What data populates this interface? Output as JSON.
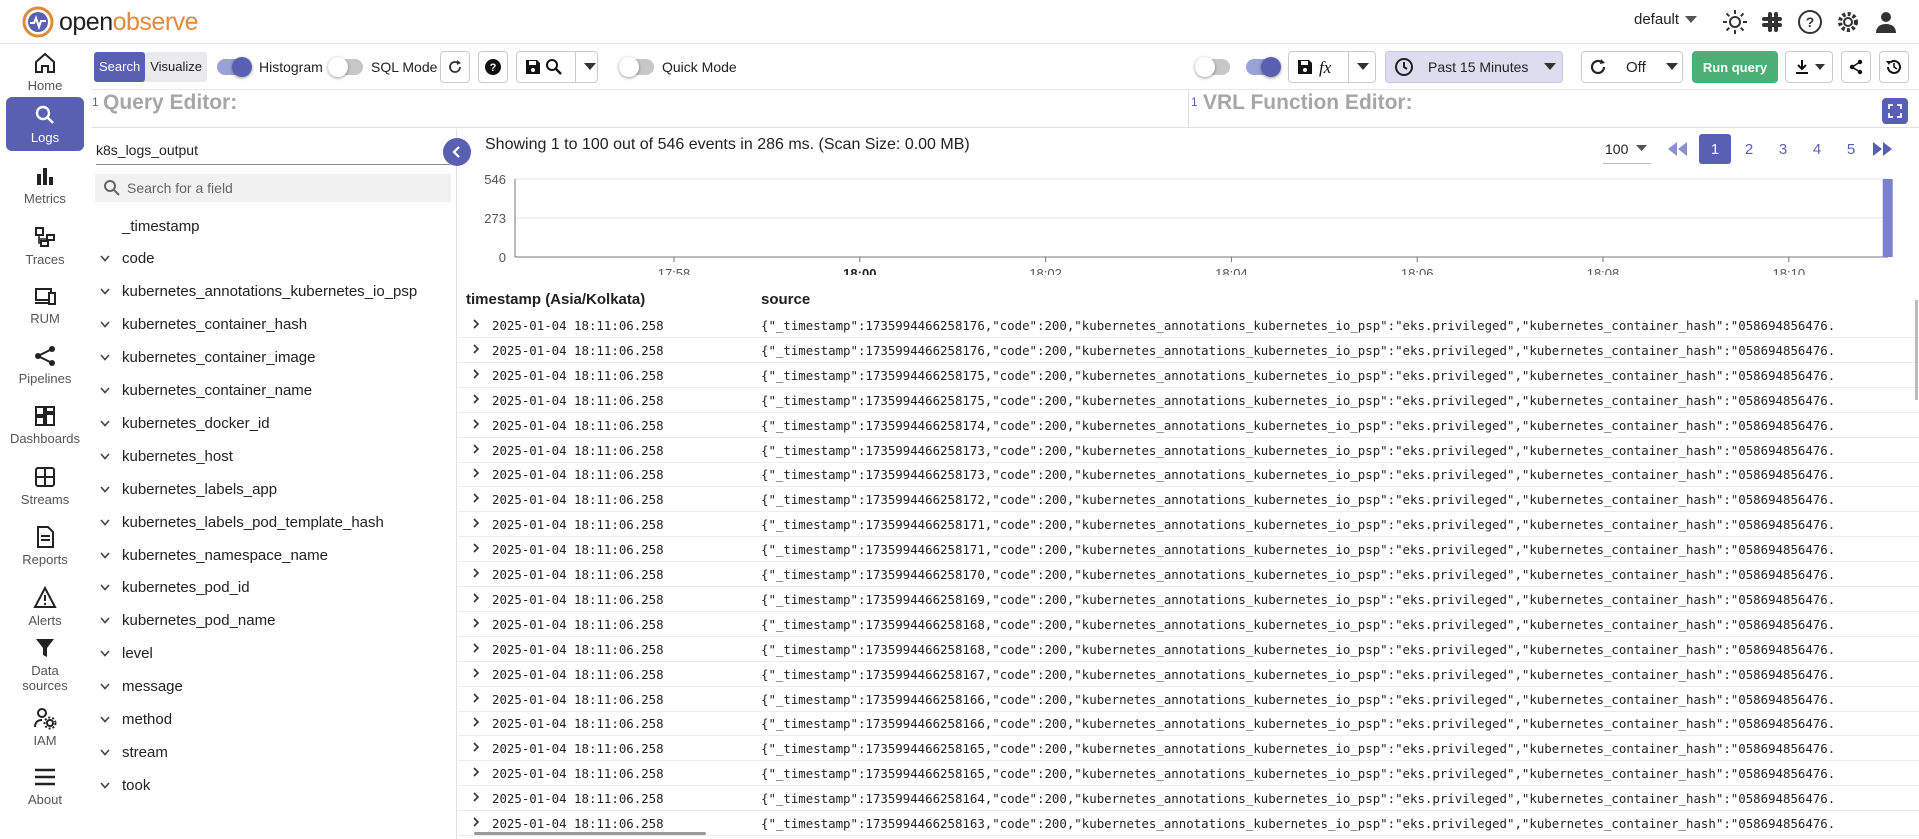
{
  "app": {
    "brand_open": "open",
    "brand_observe": "observe",
    "org": "default"
  },
  "colors": {
    "accent": "#5960b2",
    "bar": "#7b80d0",
    "run": "#4caf76"
  },
  "nav": [
    {
      "label": "Home",
      "icon": "home-icon"
    },
    {
      "label": "Logs",
      "icon": "search-icon",
      "active": true
    },
    {
      "label": "Metrics",
      "icon": "bar-chart-icon"
    },
    {
      "label": "Traces",
      "icon": "traces-icon"
    },
    {
      "label": "RUM",
      "icon": "devices-icon"
    },
    {
      "label": "Pipelines",
      "icon": "share-nodes-icon"
    },
    {
      "label": "Dashboards",
      "icon": "dashboard-grid-icon"
    },
    {
      "label": "Streams",
      "icon": "streams-grid-icon"
    },
    {
      "label": "Reports",
      "icon": "report-doc-icon"
    },
    {
      "label": "Alerts",
      "icon": "warning-icon"
    },
    {
      "label": "Data sources",
      "icon": "funnel-icon"
    },
    {
      "label": "IAM",
      "icon": "users-gear-icon"
    },
    {
      "label": "About",
      "icon": "list-icon"
    }
  ],
  "toolbar": {
    "search_tab": "Search",
    "visualize_tab": "Visualize",
    "histogram": "Histogram",
    "sql_mode": "SQL Mode",
    "quick_mode": "Quick Mode",
    "time_range": "Past 15 Minutes",
    "refresh": "Off",
    "run_query": "Run query"
  },
  "editors": {
    "query_label": "Query Editor:",
    "vrl_label": "VRL Function Editor:",
    "line_number": "1"
  },
  "fields": {
    "stream": "k8s_logs_output",
    "search_placeholder": "Search for a field",
    "items": [
      "_timestamp",
      "code",
      "kubernetes_annotations_kubernetes_io_psp",
      "kubernetes_container_hash",
      "kubernetes_container_image",
      "kubernetes_container_name",
      "kubernetes_docker_id",
      "kubernetes_host",
      "kubernetes_labels_app",
      "kubernetes_labels_pod_template_hash",
      "kubernetes_namespace_name",
      "kubernetes_pod_id",
      "kubernetes_pod_name",
      "level",
      "message",
      "method",
      "stream",
      "took"
    ]
  },
  "results": {
    "summary": "Showing 1 to 100 out of 546 events in 286 ms. (Scan Size: 0.00 MB)",
    "page_size": "100",
    "pages": [
      "1",
      "2",
      "3",
      "4",
      "5"
    ],
    "col_timestamp": "timestamp (Asia/Kolkata)",
    "col_source": "source"
  },
  "chart_data": {
    "type": "bar",
    "x_ticks": [
      "17:58",
      "18:00",
      "18:02",
      "18:04",
      "18:06",
      "18:08",
      "18:10"
    ],
    "y_ticks": [
      "546",
      "273",
      "0"
    ],
    "ylim": [
      0,
      546
    ],
    "bars": [
      {
        "x": "18:11",
        "value": 546
      }
    ]
  },
  "rows": [
    {
      "ts": "2025-01-04 18:11:06.258",
      "src": "{\"_timestamp\":1735994466258176,\"code\":200,\"kubernetes_annotations_kubernetes_io_psp\":\"eks.privileged\",\"kubernetes_container_hash\":\"058694856476."
    },
    {
      "ts": "2025-01-04 18:11:06.258",
      "src": "{\"_timestamp\":1735994466258176,\"code\":200,\"kubernetes_annotations_kubernetes_io_psp\":\"eks.privileged\",\"kubernetes_container_hash\":\"058694856476."
    },
    {
      "ts": "2025-01-04 18:11:06.258",
      "src": "{\"_timestamp\":1735994466258175,\"code\":200,\"kubernetes_annotations_kubernetes_io_psp\":\"eks.privileged\",\"kubernetes_container_hash\":\"058694856476."
    },
    {
      "ts": "2025-01-04 18:11:06.258",
      "src": "{\"_timestamp\":1735994466258175,\"code\":200,\"kubernetes_annotations_kubernetes_io_psp\":\"eks.privileged\",\"kubernetes_container_hash\":\"058694856476."
    },
    {
      "ts": "2025-01-04 18:11:06.258",
      "src": "{\"_timestamp\":1735994466258174,\"code\":200,\"kubernetes_annotations_kubernetes_io_psp\":\"eks.privileged\",\"kubernetes_container_hash\":\"058694856476."
    },
    {
      "ts": "2025-01-04 18:11:06.258",
      "src": "{\"_timestamp\":1735994466258173,\"code\":200,\"kubernetes_annotations_kubernetes_io_psp\":\"eks.privileged\",\"kubernetes_container_hash\":\"058694856476."
    },
    {
      "ts": "2025-01-04 18:11:06.258",
      "src": "{\"_timestamp\":1735994466258173,\"code\":200,\"kubernetes_annotations_kubernetes_io_psp\":\"eks.privileged\",\"kubernetes_container_hash\":\"058694856476."
    },
    {
      "ts": "2025-01-04 18:11:06.258",
      "src": "{\"_timestamp\":1735994466258172,\"code\":200,\"kubernetes_annotations_kubernetes_io_psp\":\"eks.privileged\",\"kubernetes_container_hash\":\"058694856476."
    },
    {
      "ts": "2025-01-04 18:11:06.258",
      "src": "{\"_timestamp\":1735994466258171,\"code\":200,\"kubernetes_annotations_kubernetes_io_psp\":\"eks.privileged\",\"kubernetes_container_hash\":\"058694856476."
    },
    {
      "ts": "2025-01-04 18:11:06.258",
      "src": "{\"_timestamp\":1735994466258171,\"code\":200,\"kubernetes_annotations_kubernetes_io_psp\":\"eks.privileged\",\"kubernetes_container_hash\":\"058694856476."
    },
    {
      "ts": "2025-01-04 18:11:06.258",
      "src": "{\"_timestamp\":1735994466258170,\"code\":200,\"kubernetes_annotations_kubernetes_io_psp\":\"eks.privileged\",\"kubernetes_container_hash\":\"058694856476."
    },
    {
      "ts": "2025-01-04 18:11:06.258",
      "src": "{\"_timestamp\":1735994466258169,\"code\":200,\"kubernetes_annotations_kubernetes_io_psp\":\"eks.privileged\",\"kubernetes_container_hash\":\"058694856476."
    },
    {
      "ts": "2025-01-04 18:11:06.258",
      "src": "{\"_timestamp\":1735994466258168,\"code\":200,\"kubernetes_annotations_kubernetes_io_psp\":\"eks.privileged\",\"kubernetes_container_hash\":\"058694856476."
    },
    {
      "ts": "2025-01-04 18:11:06.258",
      "src": "{\"_timestamp\":1735994466258168,\"code\":200,\"kubernetes_annotations_kubernetes_io_psp\":\"eks.privileged\",\"kubernetes_container_hash\":\"058694856476."
    },
    {
      "ts": "2025-01-04 18:11:06.258",
      "src": "{\"_timestamp\":1735994466258167,\"code\":200,\"kubernetes_annotations_kubernetes_io_psp\":\"eks.privileged\",\"kubernetes_container_hash\":\"058694856476."
    },
    {
      "ts": "2025-01-04 18:11:06.258",
      "src": "{\"_timestamp\":1735994466258166,\"code\":200,\"kubernetes_annotations_kubernetes_io_psp\":\"eks.privileged\",\"kubernetes_container_hash\":\"058694856476."
    },
    {
      "ts": "2025-01-04 18:11:06.258",
      "src": "{\"_timestamp\":1735994466258166,\"code\":200,\"kubernetes_annotations_kubernetes_io_psp\":\"eks.privileged\",\"kubernetes_container_hash\":\"058694856476."
    },
    {
      "ts": "2025-01-04 18:11:06.258",
      "src": "{\"_timestamp\":1735994466258165,\"code\":200,\"kubernetes_annotations_kubernetes_io_psp\":\"eks.privileged\",\"kubernetes_container_hash\":\"058694856476."
    },
    {
      "ts": "2025-01-04 18:11:06.258",
      "src": "{\"_timestamp\":1735994466258165,\"code\":200,\"kubernetes_annotations_kubernetes_io_psp\":\"eks.privileged\",\"kubernetes_container_hash\":\"058694856476."
    },
    {
      "ts": "2025-01-04 18:11:06.258",
      "src": "{\"_timestamp\":1735994466258164,\"code\":200,\"kubernetes_annotations_kubernetes_io_psp\":\"eks.privileged\",\"kubernetes_container_hash\":\"058694856476."
    },
    {
      "ts": "2025-01-04 18:11:06.258",
      "src": "{\"_timestamp\":1735994466258163,\"code\":200,\"kubernetes_annotations_kubernetes_io_psp\":\"eks.privileged\",\"kubernetes_container_hash\":\"058694856476."
    }
  ]
}
